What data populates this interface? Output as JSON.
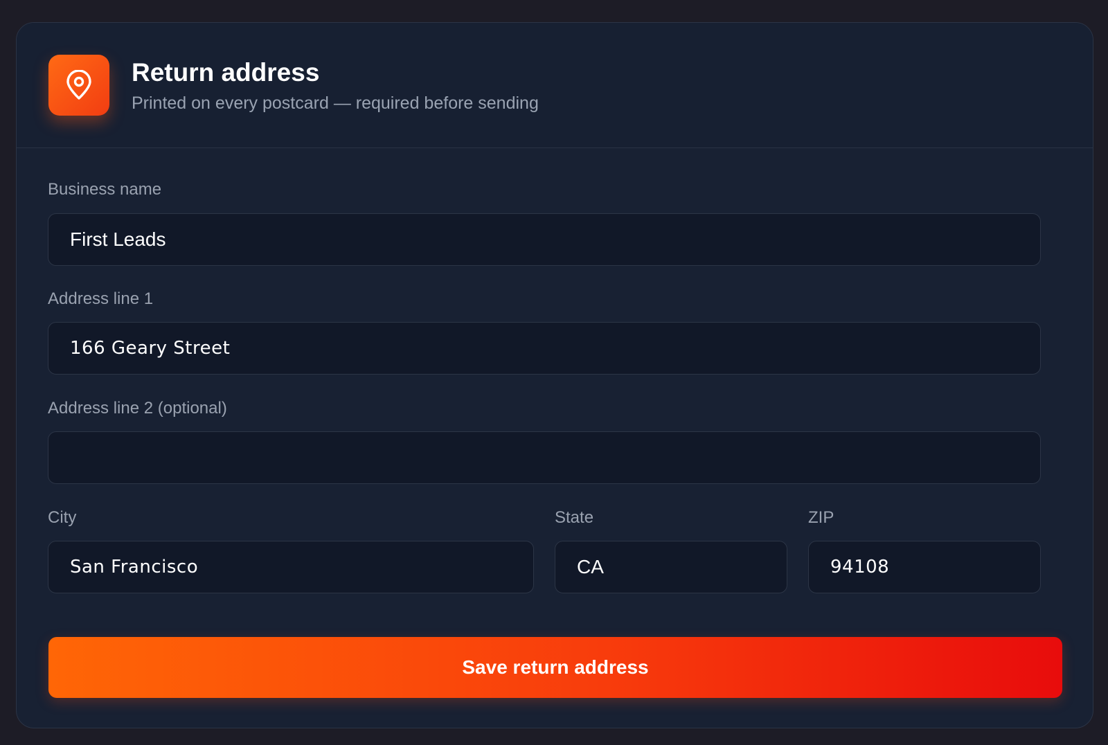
{
  "header": {
    "icon": "map-pin-icon",
    "title": "Return address",
    "subtitle": "Printed on every postcard — required before sending",
    "accent": "#ff5a14"
  },
  "form": {
    "business_name": {
      "label": "Business name",
      "value": "First Leads"
    },
    "address_line_1": {
      "label": "Address line 1",
      "value": "166 Geary Street"
    },
    "address_line_2": {
      "label": "Address line 2 (optional)",
      "value": ""
    },
    "city": {
      "label": "City",
      "value": "San Francisco"
    },
    "state": {
      "label": "State",
      "value": "CA"
    },
    "zip": {
      "label": "ZIP",
      "value": "94108"
    }
  },
  "actions": {
    "save_label": "Save return address",
    "save_gradient": [
      "#ff6606",
      "#e80c0c"
    ]
  }
}
